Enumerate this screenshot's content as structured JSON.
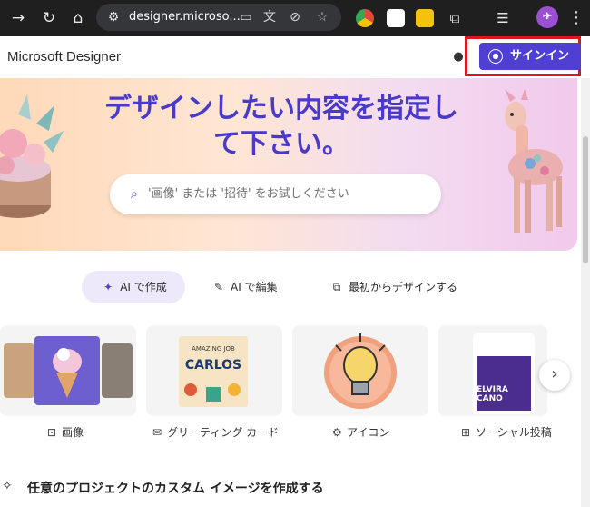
{
  "browser": {
    "url": "designer.microso...",
    "nav_icons": [
      "forward-icon",
      "reload-icon",
      "home-icon"
    ],
    "omnibox_icons": [
      "site-settings-icon",
      "cast-icon",
      "translate-icon",
      "eye-slash-icon",
      "star-icon"
    ],
    "extension_colors": [
      "#e04a3d",
      "#ffffff",
      "#f4c20d",
      "#e8e8e8",
      "#e8e8e8"
    ],
    "avatar_glyph": "✈"
  },
  "app": {
    "brand": "Microsoft Designer",
    "signin_label": "サインイン"
  },
  "hero": {
    "headline_line1": "デザインしたい内容を指定し",
    "headline_line2": "て下さい。",
    "search_placeholder": "'画像' または '招待' をお試しください"
  },
  "tabs": [
    {
      "label": "AI で作成",
      "icon": "sparkle-icon",
      "active": true
    },
    {
      "label": "AI で編集",
      "icon": "magic-pen-icon",
      "active": false
    },
    {
      "label": "最初からデザインする",
      "icon": "design-icon",
      "active": false
    }
  ],
  "cards": [
    {
      "label": "画像",
      "icon": "image-icon"
    },
    {
      "label": "グリーティング カード",
      "icon": "mail-icon"
    },
    {
      "label": "アイコン",
      "icon": "icon-icon"
    },
    {
      "label": "ソーシャル投稿",
      "icon": "social-icon"
    }
  ],
  "card_art": {
    "greeting_line1": "AMAZING JOB",
    "greeting_line2": "CARLOS",
    "social_name_line1": "ELVIRA",
    "social_name_line2": "CANO"
  },
  "section": {
    "subtitle": "任意のプロジェクトのカスタム イメージを作成する"
  },
  "colors": {
    "accent": "#4f3fd2",
    "headline": "#4a3ac8",
    "highlight_border": "#e0141c"
  }
}
